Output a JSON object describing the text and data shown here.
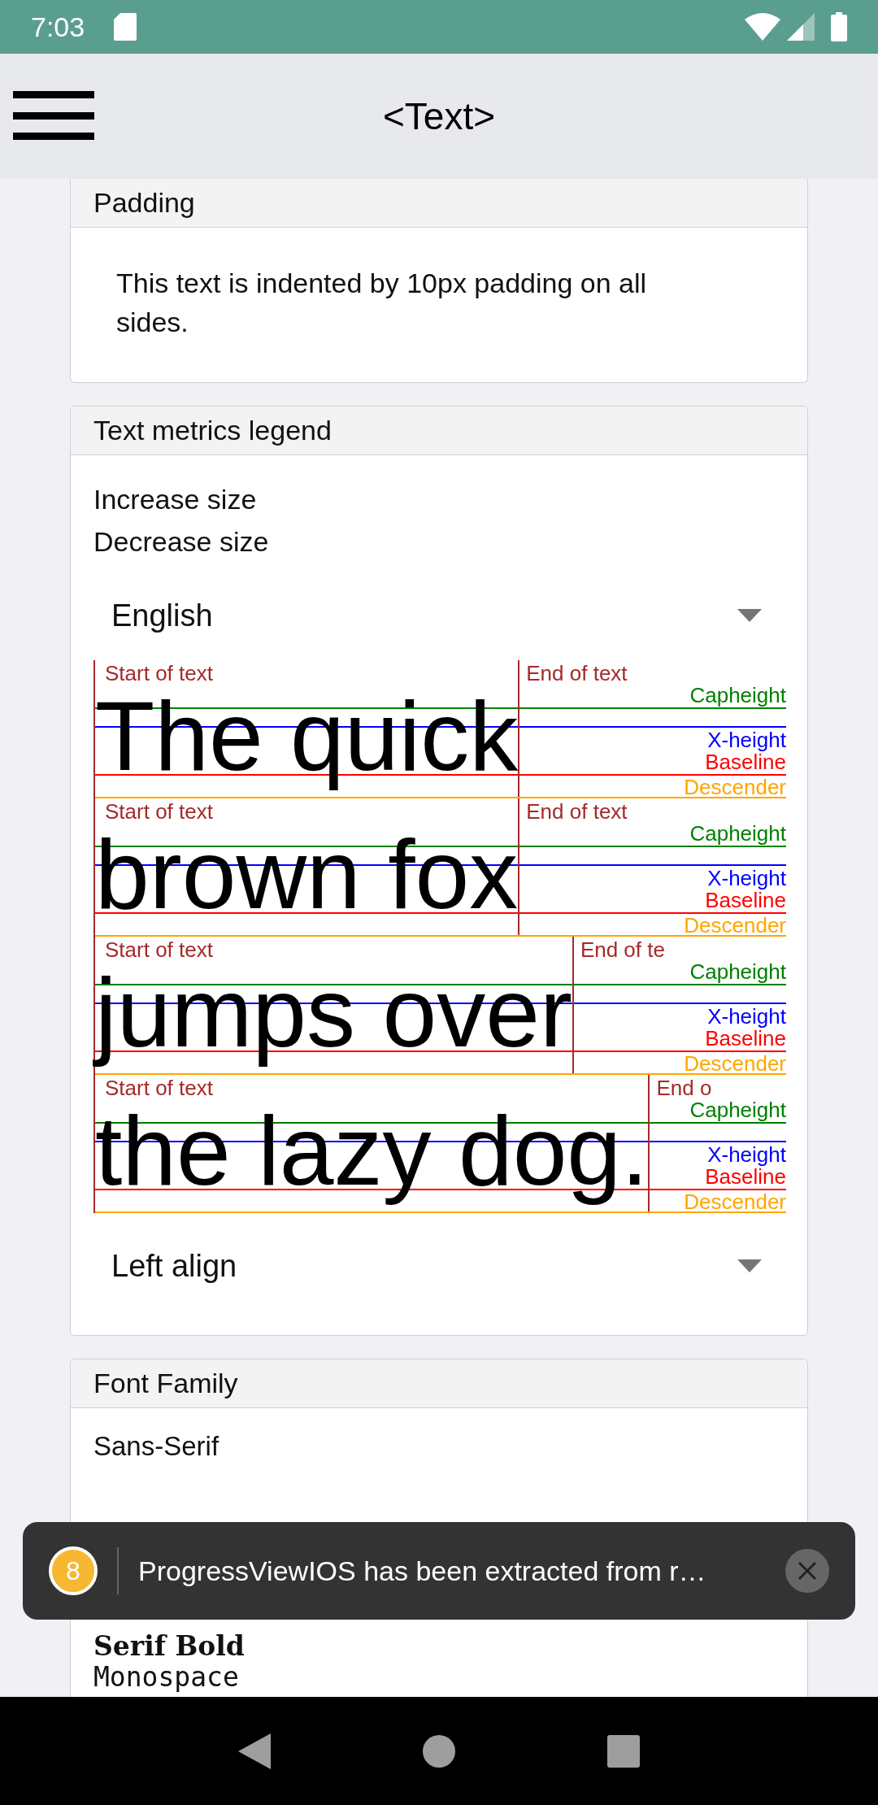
{
  "status_bar": {
    "time": "7:03"
  },
  "app_bar": {
    "title": "<Text>"
  },
  "sections": [
    {
      "kind": "padding",
      "title": "Padding",
      "text": "This text is indented by 10px padding on all sides."
    },
    {
      "kind": "metrics",
      "title": "Text metrics legend",
      "buttons": [
        "Increase size",
        "Decrease size"
      ],
      "language": "English",
      "lines": [
        {
          "text": "The quick",
          "start_label": "Start of text",
          "end_label": "End of text",
          "capheight_label": "Capheight",
          "xheight_label": "X-height",
          "baseline_label": "Baseline",
          "descender_label": "Descender"
        },
        {
          "text": "brown fox",
          "start_label": "Start of text",
          "end_label": "End of text",
          "capheight_label": "Capheight",
          "xheight_label": "X-height",
          "baseline_label": "Baseline",
          "descender_label": "Descender"
        },
        {
          "text": "jumps over",
          "start_label": "Start of text",
          "end_label": "End of te",
          "capheight_label": "Capheight",
          "xheight_label": "X-height",
          "baseline_label": "Baseline",
          "descender_label": "Descender"
        },
        {
          "text": "the lazy dog.",
          "start_label": "Start of text",
          "end_label": "End o",
          "capheight_label": "Capheight",
          "xheight_label": "X-height",
          "baseline_label": "Baseline",
          "descender_label": "Descender"
        }
      ],
      "alignment": "Left align"
    },
    {
      "kind": "fonts",
      "title": "Font Family",
      "fonts": [
        {
          "label": "Sans-Serif",
          "kind": "sans"
        },
        {
          "label": "Serif Bold",
          "kind": "serif-bold"
        },
        {
          "label": "Monospace",
          "kind": "mono"
        }
      ]
    }
  ],
  "toast": {
    "count": "8",
    "message": "ProgressViewIOS has been extracted from r…"
  }
}
